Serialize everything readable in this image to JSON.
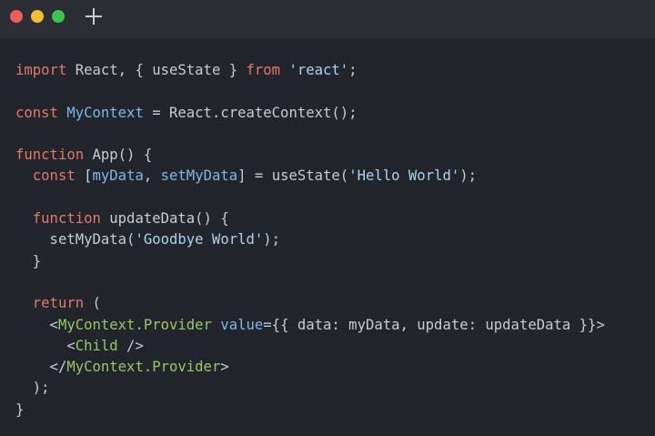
{
  "window": {
    "controls": {
      "close": {
        "icon": "close-dot-icon",
        "color": "#ee5f5b"
      },
      "minimize": {
        "icon": "minimize-dot-icon",
        "color": "#f2be35"
      },
      "maximize": {
        "icon": "maximize-dot-icon",
        "color": "#3ec44e"
      },
      "new_tab": {
        "icon": "plus-icon"
      }
    }
  },
  "colors": {
    "keyword": "#e07a6a",
    "tag": "#98c76a",
    "identifier": "#7fb8e6",
    "string": "#a8d4ef",
    "text": "#c8ccd3",
    "background": "#22252b",
    "titlebar": "#2b2e34"
  },
  "code": {
    "lines": [
      [
        {
          "t": "import",
          "c": "kw"
        },
        {
          "t": " React, { useState } ",
          "c": "plain"
        },
        {
          "t": "from",
          "c": "kw"
        },
        {
          "t": " ",
          "c": "plain"
        },
        {
          "t": "'react'",
          "c": "str"
        },
        {
          "t": ";",
          "c": "plain"
        }
      ],
      [],
      [
        {
          "t": "const",
          "c": "kw"
        },
        {
          "t": " ",
          "c": "plain"
        },
        {
          "t": "MyContext",
          "c": "var"
        },
        {
          "t": " = React.createContext();",
          "c": "plain"
        }
      ],
      [],
      [
        {
          "t": "function",
          "c": "kw"
        },
        {
          "t": " App() {",
          "c": "plain"
        }
      ],
      [
        {
          "t": "  ",
          "c": "plain"
        },
        {
          "t": "const",
          "c": "kw"
        },
        {
          "t": " [",
          "c": "plain"
        },
        {
          "t": "myData",
          "c": "var"
        },
        {
          "t": ", ",
          "c": "plain"
        },
        {
          "t": "setMyData",
          "c": "var"
        },
        {
          "t": "] = useState(",
          "c": "plain"
        },
        {
          "t": "'Hello World'",
          "c": "str"
        },
        {
          "t": ");",
          "c": "plain"
        }
      ],
      [],
      [
        {
          "t": "  ",
          "c": "plain"
        },
        {
          "t": "function",
          "c": "kw"
        },
        {
          "t": " updateData() {",
          "c": "plain"
        }
      ],
      [
        {
          "t": "    setMyData(",
          "c": "plain"
        },
        {
          "t": "'Goodbye World'",
          "c": "str"
        },
        {
          "t": ");",
          "c": "plain"
        }
      ],
      [
        {
          "t": "  }",
          "c": "plain"
        }
      ],
      [],
      [
        {
          "t": "  ",
          "c": "plain"
        },
        {
          "t": "return",
          "c": "kw"
        },
        {
          "t": " (",
          "c": "plain"
        }
      ],
      [
        {
          "t": "    <",
          "c": "plain"
        },
        {
          "t": "MyContext.Provider",
          "c": "tag"
        },
        {
          "t": " ",
          "c": "plain"
        },
        {
          "t": "value",
          "c": "attr"
        },
        {
          "t": "={{ data: myData, update: updateData }}>",
          "c": "plain"
        }
      ],
      [
        {
          "t": "      <",
          "c": "plain"
        },
        {
          "t": "Child",
          "c": "tag"
        },
        {
          "t": " />",
          "c": "plain"
        }
      ],
      [
        {
          "t": "    </",
          "c": "plain"
        },
        {
          "t": "MyContext.Provider",
          "c": "tag"
        },
        {
          "t": ">",
          "c": "plain"
        }
      ],
      [
        {
          "t": "  );",
          "c": "plain"
        }
      ],
      [
        {
          "t": "}",
          "c": "plain"
        }
      ]
    ]
  }
}
